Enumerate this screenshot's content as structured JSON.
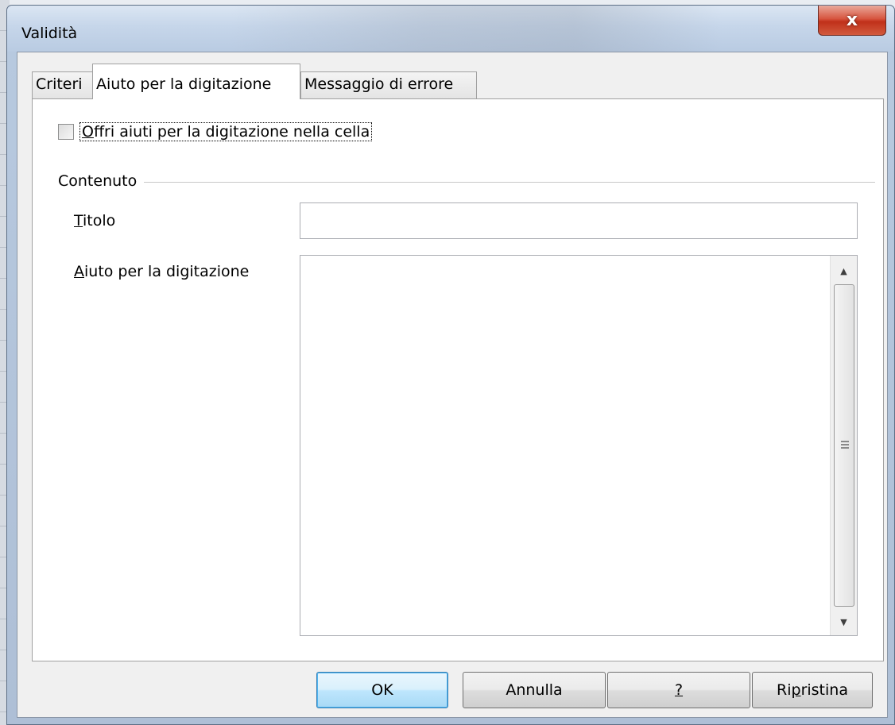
{
  "window": {
    "title": "Validità",
    "close_symbol": "x"
  },
  "tabs": [
    {
      "label": "Criteri",
      "active": false
    },
    {
      "label": "Aiuto per la digitazione",
      "active": true
    },
    {
      "label": "Messaggio di errore",
      "active": false
    }
  ],
  "panel": {
    "checkbox": {
      "mnemonic": "O",
      "rest": "ffri aiuti per la digitazione nella cella",
      "checked": false
    },
    "group_title": "Contenuto",
    "title_field": {
      "mnemonic": "T",
      "rest": "itolo",
      "value": ""
    },
    "help_field": {
      "mnemonic": "A",
      "rest": "iuto per la digitazione",
      "value": ""
    }
  },
  "buttons": {
    "ok": "OK",
    "cancel": "Annulla",
    "help": "?",
    "reset_before": "Ri",
    "reset_mnemonic": "p",
    "reset_after": "ristina"
  },
  "icons": {
    "scroll_up": "up-arrow-icon",
    "scroll_down": "down-arrow-icon",
    "thumb_grip": "grip-icon"
  },
  "colors": {
    "default_button_border": "#3c7fb1",
    "close_button": "#c0301a"
  }
}
